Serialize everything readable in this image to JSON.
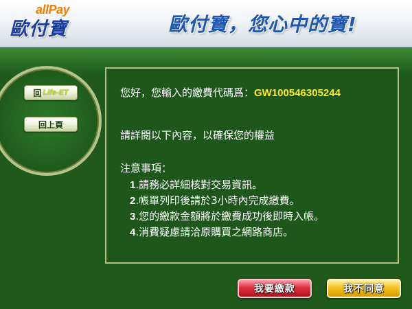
{
  "header": {
    "logo_top": "allPay",
    "logo_main": "歐付寶",
    "slogan": "歐付寶，您心中的寶!"
  },
  "sidebar": {
    "life_button_prefix": "回",
    "life_button_brand": "Life-ET",
    "back_button": "回上頁"
  },
  "main": {
    "greeting_prefix": "您好，您輸入的繳費代碼爲：",
    "payment_code": "GW100546305244",
    "instruction": "請詳閱以下內容，以確保您的權益",
    "notes_title": "注意事項：",
    "notes": [
      {
        "num": "1",
        "text": ".請務必詳細核對交易資訊。"
      },
      {
        "num": "2",
        "text": ".帳單列印後請於3小時內完成繳費。"
      },
      {
        "num": "3",
        "text": ".您的繳款金額將於繳費成功後即時入帳。"
      },
      {
        "num": "4",
        "text": ".消費疑慮請洽原購買之網路商店。"
      }
    ]
  },
  "actions": {
    "pay_label": "我要繳款",
    "disagree_label": "我不同意"
  },
  "colors": {
    "background": "#1f5a1c",
    "code_highlight": "#ffe92b",
    "pay_button": "#e0313f",
    "disagree_button": "#f4c21f"
  }
}
